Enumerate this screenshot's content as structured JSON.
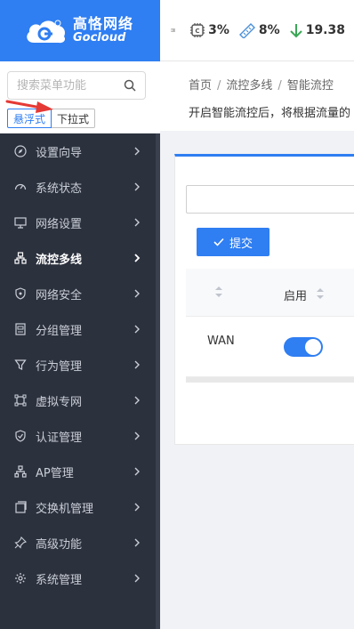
{
  "brand": {
    "name_cn": "高恪网络",
    "name_en": "Gocloud",
    "color": "#2f7ef2"
  },
  "topbar": {
    "cpu": "3%",
    "mem": "8%",
    "download": "19.38"
  },
  "sidebar": {
    "search_placeholder": "搜索菜单功能",
    "mode_float": "悬浮式",
    "mode_dropdown": "下拉式",
    "items": [
      {
        "label": "设置向导",
        "icon": "compass-icon"
      },
      {
        "label": "系统状态",
        "icon": "dashboard-icon"
      },
      {
        "label": "网络设置",
        "icon": "monitor-icon"
      },
      {
        "label": "流控多线",
        "icon": "network-icon",
        "active": true
      },
      {
        "label": "网络安全",
        "icon": "shield-icon"
      },
      {
        "label": "分组管理",
        "icon": "group-icon"
      },
      {
        "label": "行为管理",
        "icon": "filter-icon"
      },
      {
        "label": "虚拟专网",
        "icon": "vpn-icon"
      },
      {
        "label": "认证管理",
        "icon": "shield-check-icon"
      },
      {
        "label": "AP管理",
        "icon": "ap-icon"
      },
      {
        "label": "交换机管理",
        "icon": "switch-icon"
      },
      {
        "label": "高级功能",
        "icon": "pin-icon"
      },
      {
        "label": "系统管理",
        "icon": "gear-icon"
      }
    ]
  },
  "breadcrumb": [
    "首页",
    "流控多线",
    "智能流控"
  ],
  "description": "开启智能流控后，将根据流量的",
  "card": {
    "submit_label": "提交",
    "col_enable": "启用",
    "rows": [
      {
        "name": "WAN",
        "enabled": true
      }
    ]
  }
}
